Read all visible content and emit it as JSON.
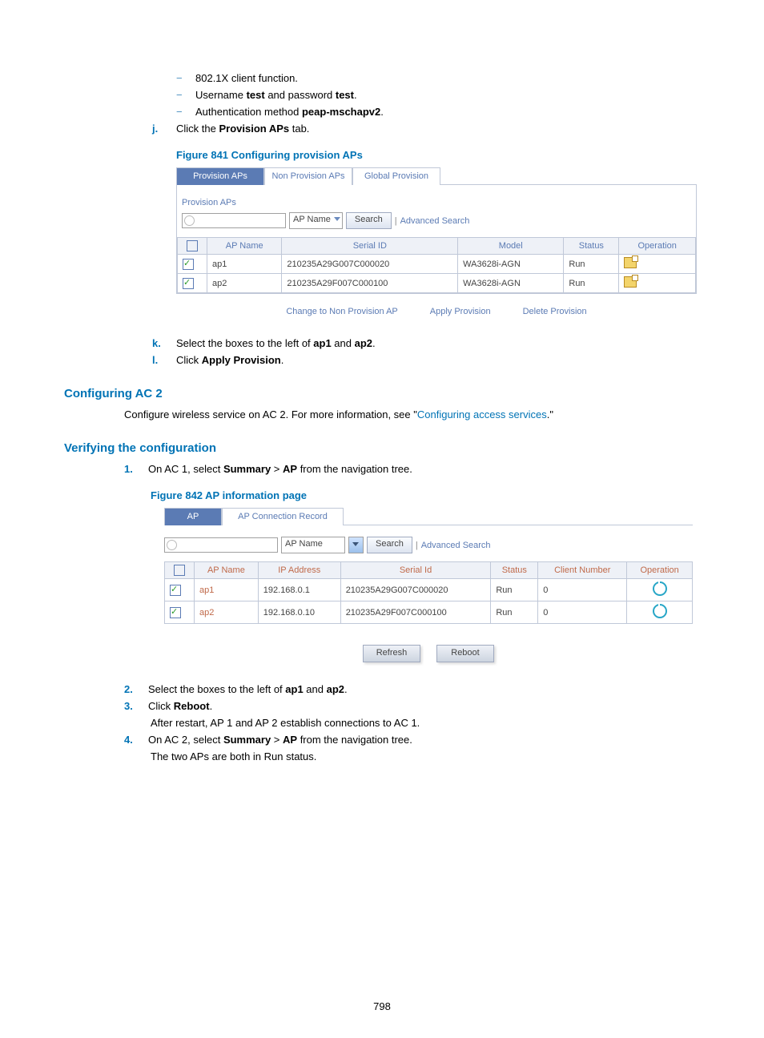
{
  "bullets": {
    "b0": "802.1X client function.",
    "b1_pre": "Username ",
    "b1_bold1": "test",
    "b1_mid": " and password ",
    "b1_bold2": "test",
    "b1_post": ".",
    "b2_pre": "Authentication method ",
    "b2_bold": "peap-mschapv2",
    "b2_post": "."
  },
  "step_j": {
    "marker": "j.",
    "pre": "Click the ",
    "bold": "Provision APs",
    "post": " tab."
  },
  "fig841": {
    "caption": "Figure 841 Configuring provision APs",
    "tabs": {
      "t0": "Provision APs",
      "t1": "Non Provision APs",
      "t2": "Global Provision"
    },
    "subheader": "Provision APs",
    "search": {
      "dropdown": "AP Name",
      "search_btn": "Search",
      "pipe": "|",
      "adv": "Advanced Search"
    },
    "cols": {
      "c1": "AP Name",
      "c2": "Serial ID",
      "c3": "Model",
      "c4": "Status",
      "c5": "Operation"
    },
    "rows": [
      {
        "ap": "ap1",
        "serial": "210235A29G007C000020",
        "model": "WA3628i-AGN",
        "status": "Run"
      },
      {
        "ap": "ap2",
        "serial": "210235A29F007C000100",
        "model": "WA3628i-AGN",
        "status": "Run"
      }
    ],
    "actions": {
      "a0": "Change to Non Provision AP",
      "a1": "Apply Provision",
      "a2": "Delete Provision"
    }
  },
  "step_k": {
    "marker": "k.",
    "pre": "Select the boxes to the left of ",
    "b1": "ap1",
    "mid": " and ",
    "b2": "ap2",
    "post": "."
  },
  "step_l": {
    "marker": "l.",
    "pre": "Click ",
    "bold": "Apply Provision",
    "post": "."
  },
  "sec_ac2": {
    "title": "Configuring AC 2",
    "pre": "Configure wireless service on AC 2. For more information, see \"",
    "link": "Configuring access services",
    "post": ".\""
  },
  "sec_verify": {
    "title": "Verifying the configuration"
  },
  "step1": {
    "marker": "1.",
    "pre": "On AC 1, select ",
    "b1": "Summary",
    "gt": " > ",
    "b2": "AP",
    "post": " from the navigation tree."
  },
  "fig842": {
    "caption": "Figure 842 AP information page",
    "tabs": {
      "t0": "AP",
      "t1": "AP Connection Record"
    },
    "search": {
      "dropdown": "AP Name",
      "search_btn": "Search",
      "pipe": "|",
      "adv": "Advanced Search"
    },
    "cols": {
      "c1": "AP Name",
      "c2": "IP Address",
      "c3": "Serial Id",
      "c4": "Status",
      "c5": "Client Number",
      "c6": "Operation"
    },
    "rows": [
      {
        "ap": "ap1",
        "ip": "192.168.0.1",
        "serial": "210235A29G007C000020",
        "status": "Run",
        "clients": "0"
      },
      {
        "ap": "ap2",
        "ip": "192.168.0.10",
        "serial": "210235A29F007C000100",
        "status": "Run",
        "clients": "0"
      }
    ],
    "actions": {
      "refresh": "Refresh",
      "reboot": "Reboot"
    }
  },
  "step2": {
    "marker": "2.",
    "pre": "Select the boxes to the left of ",
    "b1": "ap1",
    "mid": " and ",
    "b2": "ap2",
    "post": "."
  },
  "step3": {
    "marker": "3.",
    "pre": "Click ",
    "bold": "Reboot",
    "post": ".",
    "after": "After restart, AP 1 and AP 2 establish connections to AC 1."
  },
  "step4": {
    "marker": "4.",
    "pre": "On AC 2, select ",
    "b1": "Summary",
    "gt": " > ",
    "b2": "AP",
    "post": " from the navigation tree.",
    "after": "The two APs are both in Run status."
  },
  "pagenum": "798"
}
